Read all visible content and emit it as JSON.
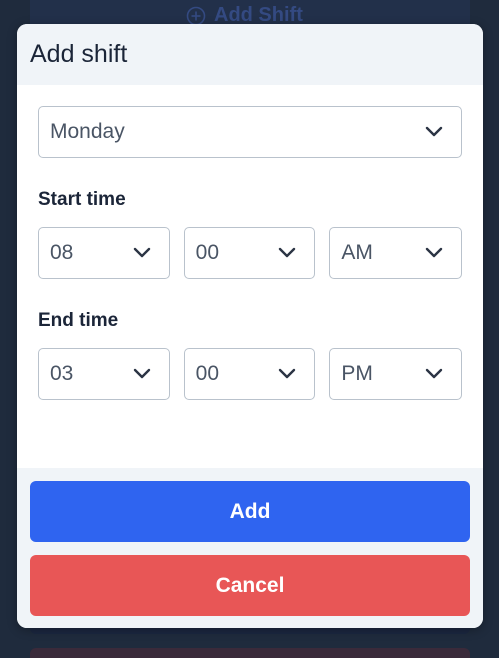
{
  "background": {
    "add_shift_label": "Add Shift"
  },
  "modal": {
    "title": "Add shift",
    "day_select": {
      "value": "Monday"
    },
    "start_time": {
      "label": "Start time",
      "hour": "08",
      "minute": "00",
      "period": "AM"
    },
    "end_time": {
      "label": "End time",
      "hour": "03",
      "minute": "00",
      "period": "PM"
    },
    "buttons": {
      "add": "Add",
      "cancel": "Cancel"
    }
  },
  "colors": {
    "primary": "#2f64f0",
    "danger": "#e85656",
    "header_bg": "#f0f4f8",
    "page_bg": "#1f2b3d"
  },
  "icons": {
    "chevron": "chevron-down-icon",
    "add_circle": "plus-circle-icon"
  }
}
